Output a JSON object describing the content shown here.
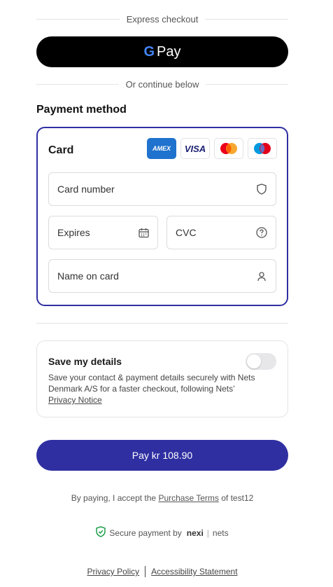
{
  "express": {
    "label": "Express checkout",
    "gpay_g": "G",
    "gpay_label": "Pay"
  },
  "or_label": "Or continue below",
  "payment_method_title": "Payment method",
  "card": {
    "title": "Card",
    "brands": {
      "amex": "AMEX",
      "visa": "VISA"
    },
    "card_number_placeholder": "Card number",
    "expires_placeholder": "Expires",
    "cvc_placeholder": "CVC",
    "name_placeholder": "Name on card"
  },
  "save": {
    "title": "Save my details",
    "text": "Save your contact & payment details securely with Nets Denmark A/S for a faster checkout, following Nets’ ",
    "link": "Privacy Notice"
  },
  "pay_button": "Pay kr 108.90",
  "terms": {
    "prefix": "By paying, I accept the ",
    "link": "Purchase Terms",
    "suffix": " of test12"
  },
  "secure": {
    "label": "Secure payment by",
    "nexi": "nexi",
    "nets": "nets"
  },
  "footer": {
    "privacy": "Privacy Policy",
    "accessibility": "Accessibility Statement"
  },
  "colors": {
    "accent": "#2f2fa2",
    "gpay_bg": "#000000",
    "amex": "#1f72cd"
  }
}
